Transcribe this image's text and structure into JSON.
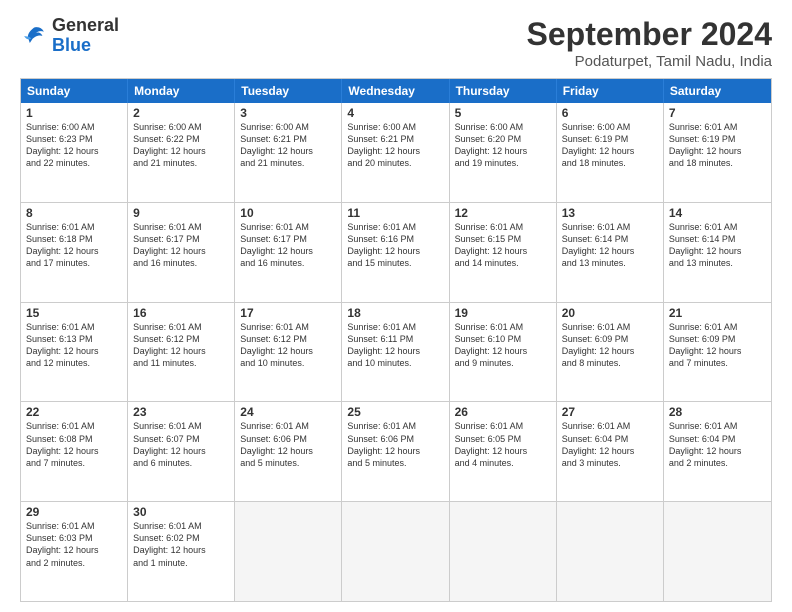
{
  "logo": {
    "line1": "General",
    "line2": "Blue"
  },
  "title": "September 2024",
  "location": "Podaturpet, Tamil Nadu, India",
  "weekdays": [
    "Sunday",
    "Monday",
    "Tuesday",
    "Wednesday",
    "Thursday",
    "Friday",
    "Saturday"
  ],
  "rows": [
    [
      {
        "day": "",
        "empty": true
      },
      {
        "day": "",
        "empty": true
      },
      {
        "day": "",
        "empty": true
      },
      {
        "day": "",
        "empty": true
      },
      {
        "day": "",
        "empty": true
      },
      {
        "day": "",
        "empty": true
      },
      {
        "day": "",
        "empty": true
      }
    ],
    [
      {
        "day": "1",
        "info": "Sunrise: 6:00 AM\nSunset: 6:23 PM\nDaylight: 12 hours\nand 22 minutes."
      },
      {
        "day": "2",
        "info": "Sunrise: 6:00 AM\nSunset: 6:22 PM\nDaylight: 12 hours\nand 21 minutes."
      },
      {
        "day": "3",
        "info": "Sunrise: 6:00 AM\nSunset: 6:21 PM\nDaylight: 12 hours\nand 21 minutes."
      },
      {
        "day": "4",
        "info": "Sunrise: 6:00 AM\nSunset: 6:21 PM\nDaylight: 12 hours\nand 20 minutes."
      },
      {
        "day": "5",
        "info": "Sunrise: 6:00 AM\nSunset: 6:20 PM\nDaylight: 12 hours\nand 19 minutes."
      },
      {
        "day": "6",
        "info": "Sunrise: 6:00 AM\nSunset: 6:19 PM\nDaylight: 12 hours\nand 18 minutes."
      },
      {
        "day": "7",
        "info": "Sunrise: 6:01 AM\nSunset: 6:19 PM\nDaylight: 12 hours\nand 18 minutes."
      }
    ],
    [
      {
        "day": "8",
        "info": "Sunrise: 6:01 AM\nSunset: 6:18 PM\nDaylight: 12 hours\nand 17 minutes."
      },
      {
        "day": "9",
        "info": "Sunrise: 6:01 AM\nSunset: 6:17 PM\nDaylight: 12 hours\nand 16 minutes."
      },
      {
        "day": "10",
        "info": "Sunrise: 6:01 AM\nSunset: 6:17 PM\nDaylight: 12 hours\nand 16 minutes."
      },
      {
        "day": "11",
        "info": "Sunrise: 6:01 AM\nSunset: 6:16 PM\nDaylight: 12 hours\nand 15 minutes."
      },
      {
        "day": "12",
        "info": "Sunrise: 6:01 AM\nSunset: 6:15 PM\nDaylight: 12 hours\nand 14 minutes."
      },
      {
        "day": "13",
        "info": "Sunrise: 6:01 AM\nSunset: 6:14 PM\nDaylight: 12 hours\nand 13 minutes."
      },
      {
        "day": "14",
        "info": "Sunrise: 6:01 AM\nSunset: 6:14 PM\nDaylight: 12 hours\nand 13 minutes."
      }
    ],
    [
      {
        "day": "15",
        "info": "Sunrise: 6:01 AM\nSunset: 6:13 PM\nDaylight: 12 hours\nand 12 minutes."
      },
      {
        "day": "16",
        "info": "Sunrise: 6:01 AM\nSunset: 6:12 PM\nDaylight: 12 hours\nand 11 minutes."
      },
      {
        "day": "17",
        "info": "Sunrise: 6:01 AM\nSunset: 6:12 PM\nDaylight: 12 hours\nand 10 minutes."
      },
      {
        "day": "18",
        "info": "Sunrise: 6:01 AM\nSunset: 6:11 PM\nDaylight: 12 hours\nand 10 minutes."
      },
      {
        "day": "19",
        "info": "Sunrise: 6:01 AM\nSunset: 6:10 PM\nDaylight: 12 hours\nand 9 minutes."
      },
      {
        "day": "20",
        "info": "Sunrise: 6:01 AM\nSunset: 6:09 PM\nDaylight: 12 hours\nand 8 minutes."
      },
      {
        "day": "21",
        "info": "Sunrise: 6:01 AM\nSunset: 6:09 PM\nDaylight: 12 hours\nand 7 minutes."
      }
    ],
    [
      {
        "day": "22",
        "info": "Sunrise: 6:01 AM\nSunset: 6:08 PM\nDaylight: 12 hours\nand 7 minutes."
      },
      {
        "day": "23",
        "info": "Sunrise: 6:01 AM\nSunset: 6:07 PM\nDaylight: 12 hours\nand 6 minutes."
      },
      {
        "day": "24",
        "info": "Sunrise: 6:01 AM\nSunset: 6:06 PM\nDaylight: 12 hours\nand 5 minutes."
      },
      {
        "day": "25",
        "info": "Sunrise: 6:01 AM\nSunset: 6:06 PM\nDaylight: 12 hours\nand 5 minutes."
      },
      {
        "day": "26",
        "info": "Sunrise: 6:01 AM\nSunset: 6:05 PM\nDaylight: 12 hours\nand 4 minutes."
      },
      {
        "day": "27",
        "info": "Sunrise: 6:01 AM\nSunset: 6:04 PM\nDaylight: 12 hours\nand 3 minutes."
      },
      {
        "day": "28",
        "info": "Sunrise: 6:01 AM\nSunset: 6:04 PM\nDaylight: 12 hours\nand 2 minutes."
      }
    ],
    [
      {
        "day": "29",
        "info": "Sunrise: 6:01 AM\nSunset: 6:03 PM\nDaylight: 12 hours\nand 2 minutes."
      },
      {
        "day": "30",
        "info": "Sunrise: 6:01 AM\nSunset: 6:02 PM\nDaylight: 12 hours\nand 1 minute."
      },
      {
        "day": "",
        "empty": true
      },
      {
        "day": "",
        "empty": true
      },
      {
        "day": "",
        "empty": true
      },
      {
        "day": "",
        "empty": true
      },
      {
        "day": "",
        "empty": true
      }
    ]
  ]
}
